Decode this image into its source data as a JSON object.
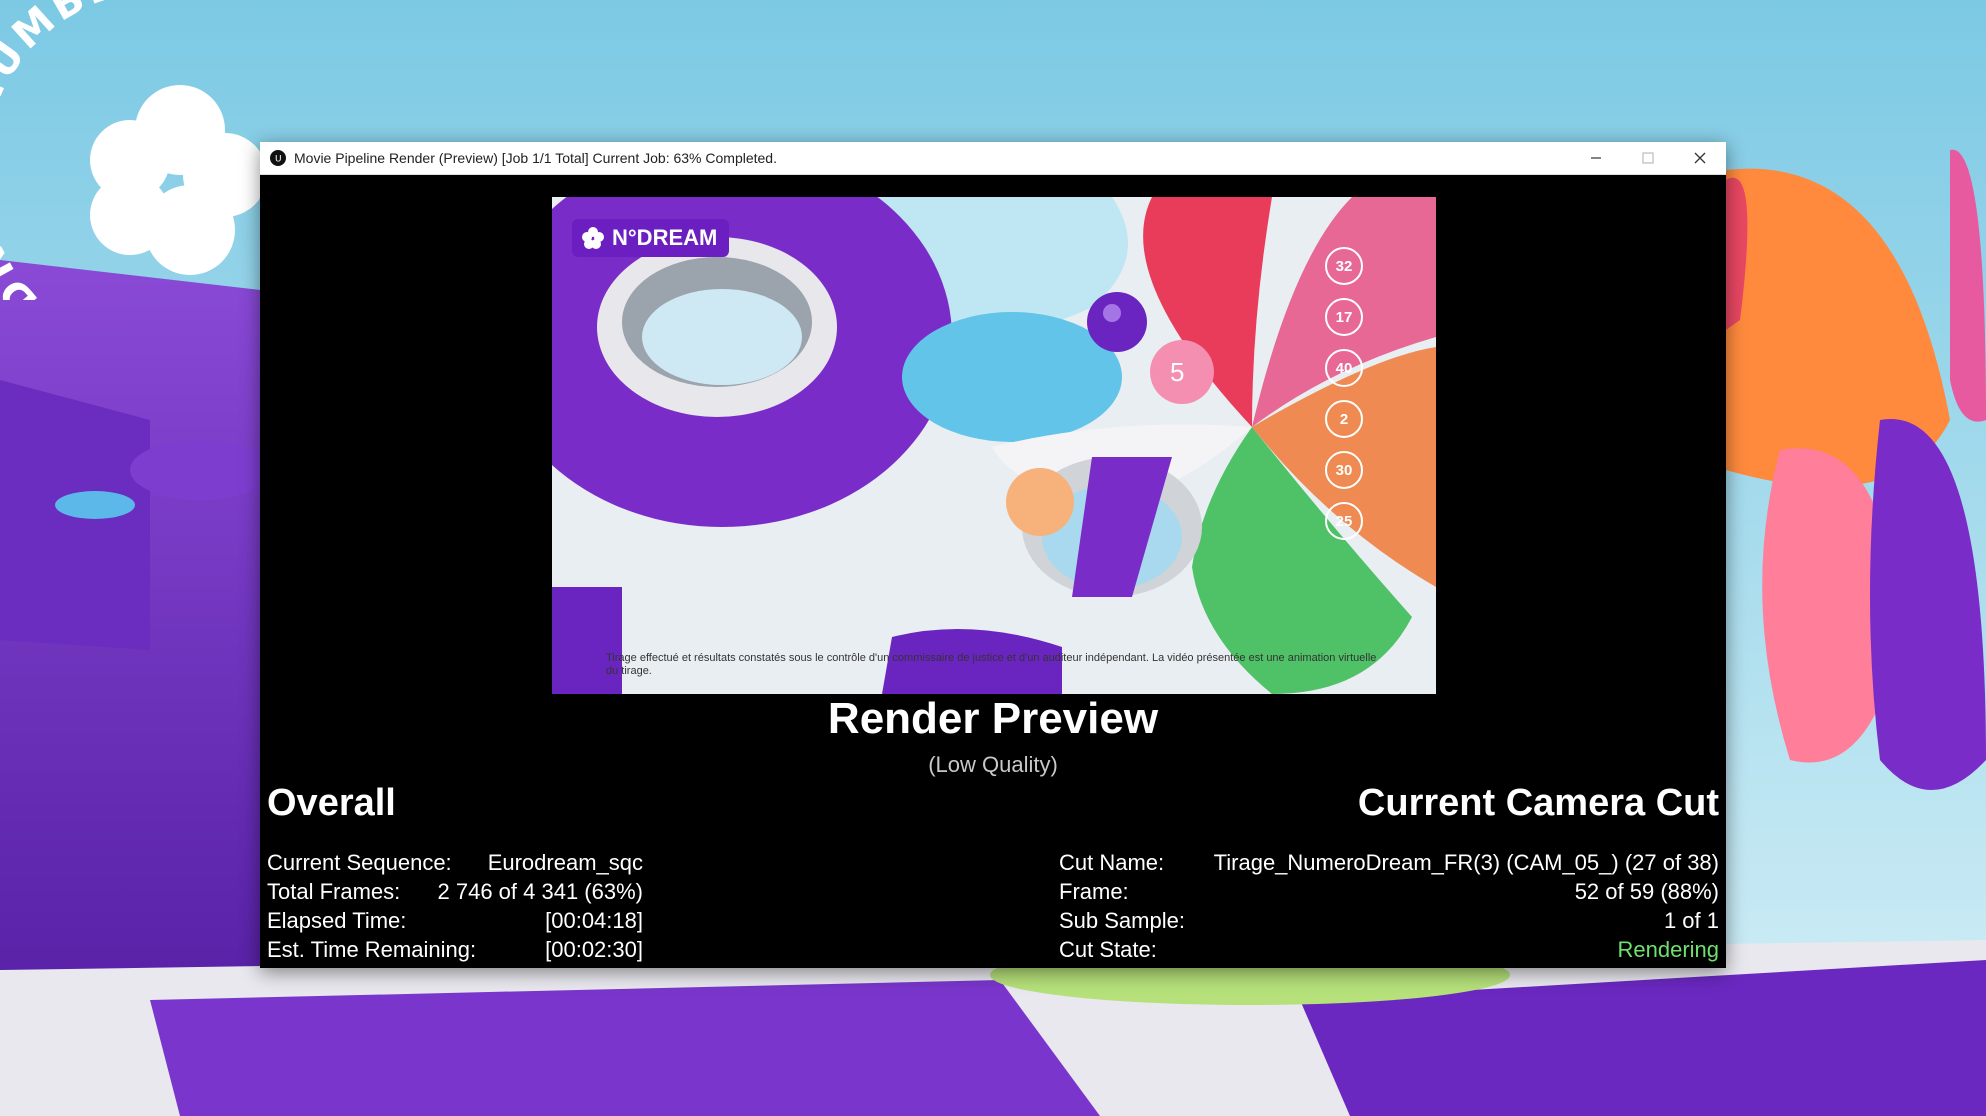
{
  "brand": {
    "arc_text": "DREAM NUMBER"
  },
  "window": {
    "title": "Movie Pipeline Render (Preview) [Job 1/1 Total] Current Job: 63% Completed.",
    "minimize_icon": "minimize-icon",
    "maximize_icon": "maximize-icon",
    "close_icon": "close-icon"
  },
  "preview": {
    "logo_text": "N°DREAM",
    "disclaimer": "Tirage effectué et résultats constatés sous le contrôle d'un commissaire de justice et d'un auditeur indépendant. La vidéo présentée est une animation virtuelle du tirage.",
    "ball_numbers": [
      "32",
      "17",
      "40",
      "2",
      "30",
      "25"
    ],
    "pink_ball_number": "5"
  },
  "render": {
    "title": "Render Preview",
    "subtitle": "(Low Quality)"
  },
  "overall": {
    "heading": "Overall",
    "rows": [
      {
        "label": "Current Sequence:",
        "value": "Eurodream_sqc"
      },
      {
        "label": "Total Frames:",
        "value": "2 746 of 4 341 (63%)"
      },
      {
        "label": "Elapsed Time:",
        "value": "[00:04:18]"
      },
      {
        "label": "Est. Time Remaining:",
        "value": "[00:02:30]"
      }
    ]
  },
  "camera_cut": {
    "heading": "Current Camera Cut",
    "rows": [
      {
        "label": "Cut Name:",
        "value": "Tirage_NumeroDream_FR(3) (CAM_05_) (27 of 38)"
      },
      {
        "label": "Frame:",
        "value": "52 of 59 (88%)"
      },
      {
        "label": "Sub Sample:",
        "value": "1 of 1"
      },
      {
        "label": "Cut State:",
        "value": "Rendering"
      }
    ],
    "state_color": "#6ee06e"
  }
}
